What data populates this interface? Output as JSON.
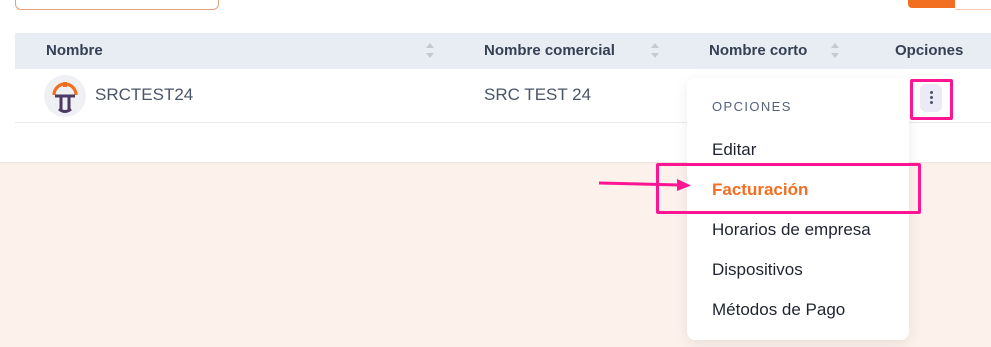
{
  "table": {
    "columns": [
      {
        "label": "Nombre"
      },
      {
        "label": "Nombre comercial"
      },
      {
        "label": "Nombre corto"
      },
      {
        "label": "Opciones"
      }
    ],
    "rows": [
      {
        "nombre": "SRCTEST24",
        "nombre_comercial": "SRC TEST 24",
        "nombre_corto": ""
      }
    ]
  },
  "menu": {
    "title": "OPCIONES",
    "items": [
      {
        "label": "Editar"
      },
      {
        "label": "Facturación",
        "active": true
      },
      {
        "label": "Horarios de empresa"
      },
      {
        "label": "Dispositivos"
      },
      {
        "label": "Métodos de Pago"
      }
    ]
  },
  "colors": {
    "accent": "#f26f21",
    "highlight": "#ff1493",
    "page_bg": "#fdf1ec",
    "header_bg": "#e8edf3"
  },
  "icons": {
    "options": "kebab-vertical-icon",
    "sort": "sort-updown-icon",
    "avatar": "company-logo-icon"
  }
}
